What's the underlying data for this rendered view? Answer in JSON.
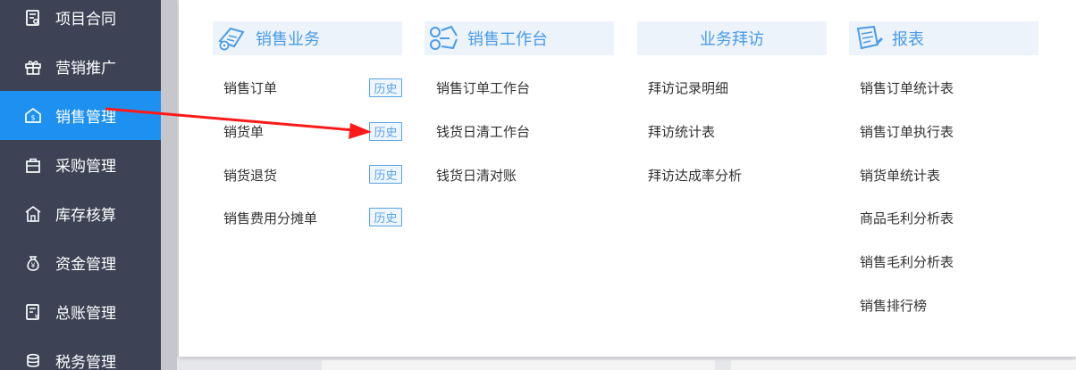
{
  "sidebar": {
    "items": [
      {
        "label": "项目合同",
        "icon": "contract-icon",
        "active": false
      },
      {
        "label": "营销推广",
        "icon": "gift-icon",
        "active": false
      },
      {
        "label": "销售管理",
        "icon": "sales-icon",
        "active": true
      },
      {
        "label": "采购管理",
        "icon": "bag-icon",
        "active": false
      },
      {
        "label": "库存核算",
        "icon": "warehouse-icon",
        "active": false
      },
      {
        "label": "资金管理",
        "icon": "money-bag-icon",
        "active": false
      },
      {
        "label": "总账管理",
        "icon": "ledger-icon",
        "active": false
      },
      {
        "label": "税务管理",
        "icon": "tax-icon",
        "active": false
      }
    ]
  },
  "menu": {
    "columns": [
      {
        "title": "销售业务",
        "icon": "sales-business-icon",
        "items": [
          "销售订单",
          "销货单",
          "销货退货",
          "销售费用分摊单"
        ]
      },
      {
        "title": "销售工作台",
        "icon": "workbench-icon",
        "items": [
          "销售订单工作台",
          "钱货日清工作台",
          "钱货日清对账"
        ]
      },
      {
        "title": "业务拜访",
        "icon": "",
        "items": [
          "拜访记录明细",
          "拜访统计表",
          "拜访达成率分析"
        ]
      },
      {
        "title": "报表",
        "icon": "report-icon",
        "items": [
          "销售订单统计表",
          "销售订单执行表",
          "销货单统计表",
          "商品毛利分析表",
          "销售毛利分析表",
          "销售排行榜"
        ]
      }
    ],
    "history_label": "历史"
  },
  "colors": {
    "sidebar_bg": "#3d4355",
    "active_bg": "#1e90f0",
    "accent": "#4a9be6",
    "annotation_arrow": "#ff1a1a"
  }
}
